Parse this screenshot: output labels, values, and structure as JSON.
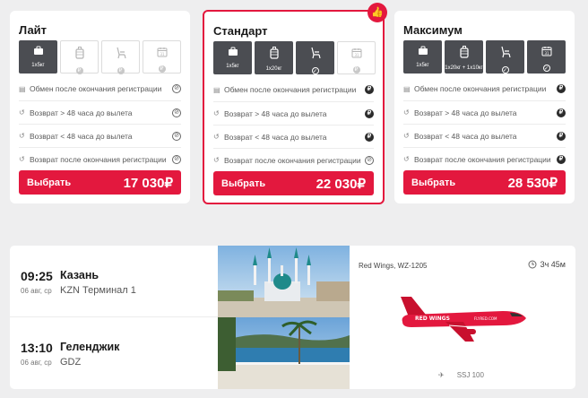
{
  "tariffs": [
    {
      "name": "Лайт",
      "icons": [
        {
          "icon": "bag-icon",
          "style": "dark",
          "label": "1x5кг",
          "mark": ""
        },
        {
          "icon": "luggage-icon",
          "style": "light",
          "label": "",
          "mark": "₽"
        },
        {
          "icon": "seat-icon",
          "style": "light",
          "label": "",
          "mark": "₽"
        },
        {
          "icon": "calendar-icon",
          "style": "light",
          "label": "",
          "mark": "₽"
        }
      ],
      "rows": [
        {
          "icon": "calendar-small-icon",
          "text": "Обмен после окончания регистрации",
          "mark": "no"
        },
        {
          "icon": "return-icon",
          "text": "Возврат > 48 часа до вылета",
          "mark": "no"
        },
        {
          "icon": "return-icon",
          "text": "Возврат < 48 часа до вылета",
          "mark": "no"
        },
        {
          "icon": "return-icon",
          "text": "Возврат после окончания регистрации",
          "mark": "no"
        }
      ],
      "button": "Выбрать",
      "price": "17 030₽"
    },
    {
      "name": "Стандарт",
      "icons": [
        {
          "icon": "bag-icon",
          "style": "dark",
          "label": "1x5кг",
          "mark": ""
        },
        {
          "icon": "luggage-icon",
          "style": "dark",
          "label": "1x20кг",
          "mark": ""
        },
        {
          "icon": "seat-icon",
          "style": "dark",
          "label": "",
          "mark": "✓"
        },
        {
          "icon": "calendar-icon",
          "style": "light",
          "label": "",
          "mark": "₽"
        }
      ],
      "rows": [
        {
          "icon": "calendar-small-icon",
          "text": "Обмен после окончания регистрации",
          "mark": "paid"
        },
        {
          "icon": "return-icon",
          "text": "Возврат > 48 часа до вылета",
          "mark": "paid"
        },
        {
          "icon": "return-icon",
          "text": "Возврат < 48 часа до вылета",
          "mark": "paid"
        },
        {
          "icon": "return-icon",
          "text": "Возврат после окончания регистрации",
          "mark": "no"
        }
      ],
      "button": "Выбрать",
      "price": "22 030₽"
    },
    {
      "name": "Максимум",
      "icons": [
        {
          "icon": "bag-icon",
          "style": "dark",
          "label": "1x5кг",
          "mark": ""
        },
        {
          "icon": "luggage-icon",
          "style": "dark",
          "label": "1x20кг + 1x10кг",
          "mark": ""
        },
        {
          "icon": "seat-icon",
          "style": "dark",
          "label": "",
          "mark": "✓"
        },
        {
          "icon": "calendar-icon",
          "style": "dark",
          "label": "",
          "mark": "✓"
        }
      ],
      "rows": [
        {
          "icon": "calendar-small-icon",
          "text": "Обмен после окончания регистрации",
          "mark": "paid"
        },
        {
          "icon": "return-icon",
          "text": "Возврат > 48 часа до вылета",
          "mark": "paid"
        },
        {
          "icon": "return-icon",
          "text": "Возврат < 48 часа до вылета",
          "mark": "paid"
        },
        {
          "icon": "return-icon",
          "text": "Возврат после окончания регистрации",
          "mark": "paid"
        }
      ],
      "button": "Выбрать",
      "price": "28 530₽"
    }
  ],
  "flight": {
    "departure": {
      "time": "09:25",
      "date": "06 авг, ср",
      "city": "Казань",
      "airport": "KZN Терминал 1"
    },
    "arrival": {
      "time": "13:10",
      "date": "06 авг, ср",
      "city": "Геленджик",
      "airport": "GDZ"
    },
    "airline": "Red Wings, WZ-1205",
    "duration": "3ч 45м",
    "aircraft": "SSJ 100"
  },
  "colors": {
    "accent": "#e3183e",
    "dark_box": "#4b4d52"
  }
}
